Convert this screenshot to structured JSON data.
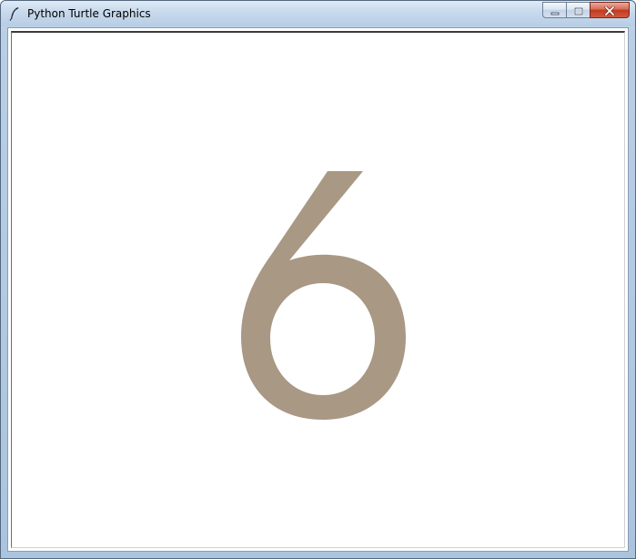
{
  "window": {
    "title": "Python Turtle Graphics",
    "app_icon": "feather-icon",
    "controls": {
      "minimize_icon": "minimize-icon",
      "maximize_icon": "maximize-icon",
      "close_icon": "close-icon"
    }
  },
  "canvas": {
    "background": "#ffffff",
    "drawn_text": "6",
    "drawn_color": "#a89884"
  }
}
